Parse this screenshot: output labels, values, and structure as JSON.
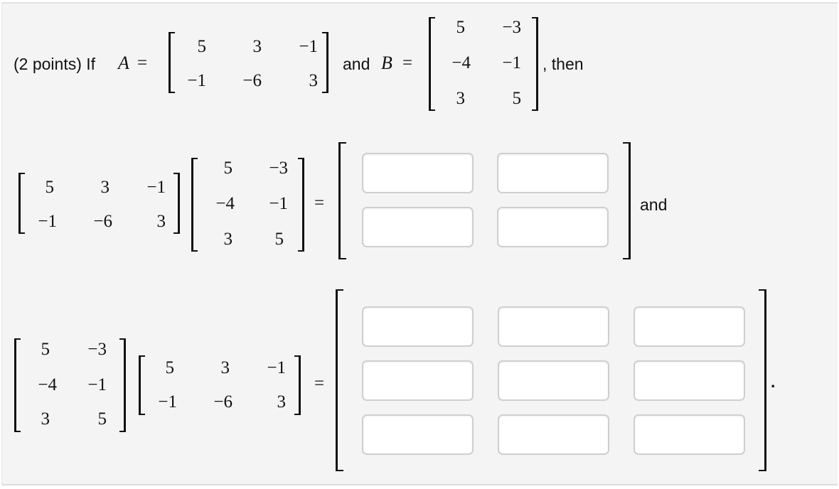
{
  "problem": {
    "points_label": "(2 points) If",
    "var_A": "A",
    "eq": "=",
    "and_B_text": "and",
    "var_B": "B",
    "then_text": ", then",
    "and_text": "and",
    "period": "."
  },
  "matrix_A": [
    [
      "5",
      "3",
      "−1"
    ],
    [
      "−1",
      "−6",
      "3"
    ]
  ],
  "matrix_B": [
    [
      "5",
      "−3"
    ],
    [
      "−4",
      "−1"
    ],
    [
      "3",
      "5"
    ]
  ],
  "product_AB": {
    "rows": 2,
    "cols": 2,
    "values": [
      [
        "",
        ""
      ],
      [
        "",
        ""
      ]
    ]
  },
  "product_BA": {
    "rows": 3,
    "cols": 3,
    "values": [
      [
        "",
        "",
        ""
      ],
      [
        "",
        "",
        ""
      ],
      [
        "",
        "",
        ""
      ]
    ]
  }
}
